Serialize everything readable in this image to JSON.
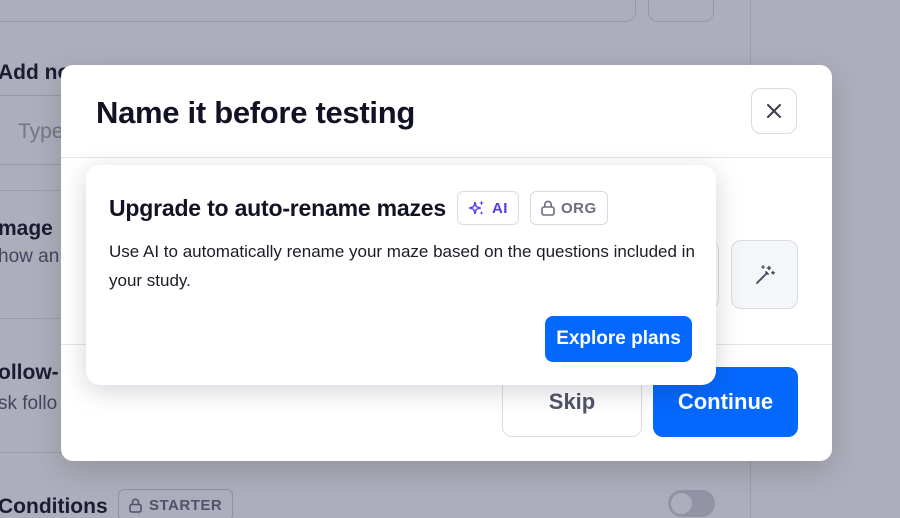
{
  "background": {
    "add_note_label": "Add no",
    "note_placeholder": "Type",
    "image_label": "mage",
    "image_sub": "how an",
    "followup_label": "ollow-",
    "followup_sub": "sk follo",
    "conditions_label": "Conditions",
    "conditions_badge": "STARTER",
    "conditions_toggle_on": false
  },
  "modal": {
    "title": "Name it before testing",
    "skip_label": "Skip",
    "continue_label": "Continue"
  },
  "upgrade_popover": {
    "title": "Upgrade to auto-rename mazes",
    "ai_badge": "AI",
    "org_badge": "ORG",
    "description": "Use AI to automatically rename your maze based on the questions included in your study.",
    "cta_label": "Explore plans"
  },
  "colors": {
    "primary": "#0568fd",
    "ai_accent": "#5b38d9",
    "overlay": "rgba(27,31,66,0.36)"
  }
}
